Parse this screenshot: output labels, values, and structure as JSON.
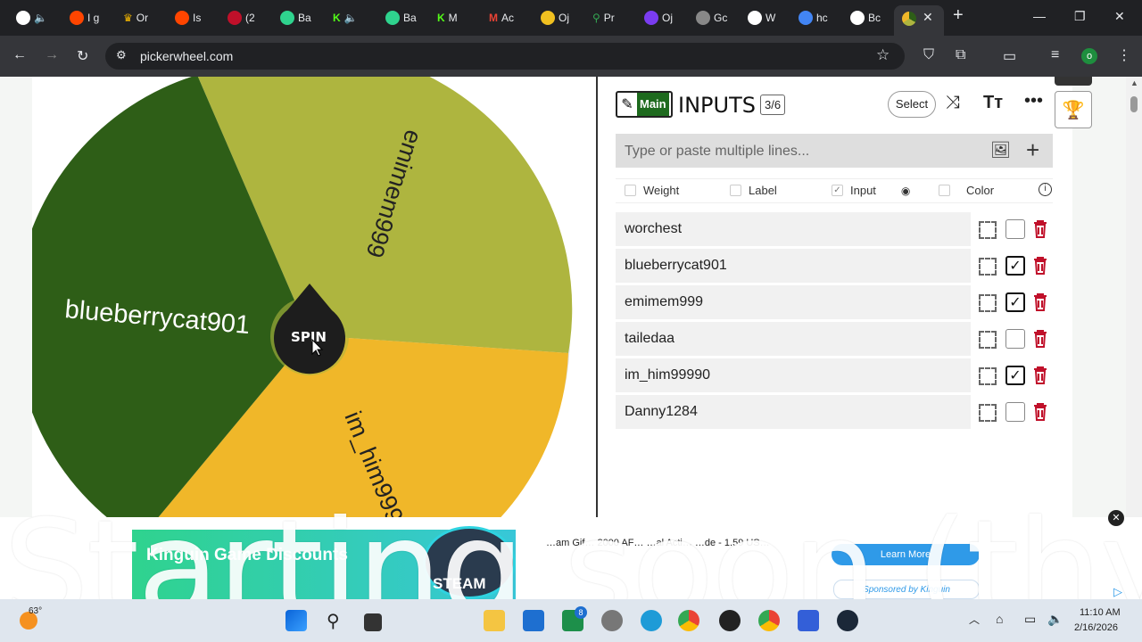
{
  "browser": {
    "tabs": [
      "I g",
      "Or",
      "Is",
      "(2",
      "Ba",
      "",
      "Ba",
      "M",
      "Ac",
      "Oj",
      "Pr",
      "Oj",
      "Gc",
      "W",
      "hc",
      "Bc"
    ],
    "url": "pickerwheel.com",
    "profile_initial": "o"
  },
  "wheel": {
    "spin_label": "SPIN",
    "slices": [
      {
        "label": "emimem999",
        "color": "#aeb53f"
      },
      {
        "label": "blueberrycat901",
        "color": "#2e5e17"
      },
      {
        "label": "im_him99990",
        "color": "#f0b729"
      }
    ]
  },
  "panel": {
    "main_label": "Main",
    "title": "INPUTS",
    "count": "3/6",
    "select_label": "Select",
    "input_placeholder": "Type or paste multiple lines...",
    "options": {
      "weight": "Weight",
      "label": "Label",
      "input": "Input",
      "color": "Color"
    },
    "entries": [
      {
        "name": "worchest",
        "checked": false
      },
      {
        "name": "blueberrycat901",
        "checked": true
      },
      {
        "name": "emimem999",
        "checked": true
      },
      {
        "name": "tailedaa",
        "checked": false
      },
      {
        "name": "im_him99990",
        "checked": true
      },
      {
        "name": "Danny1284",
        "checked": false
      }
    ]
  },
  "ad": {
    "title": "Kinguin Game Discounts",
    "steam_label": "STEAM",
    "product_text": "…am Gif… 2000 AF… …al Acti… …de - 1.59 US…",
    "cta": "Learn More",
    "sponsored": "Sponsored by Kinguin"
  },
  "caption_overlay": "Starting soon (thy",
  "taskbar": {
    "weather": "63°",
    "time": "11:10 AM",
    "date": "2/16/2026",
    "badge_count": "8"
  },
  "colors": {
    "slice_dark": "#2e5e17",
    "slice_olive": "#aeb53f",
    "slice_yellow": "#f0b729",
    "trash": "#c0102a"
  }
}
